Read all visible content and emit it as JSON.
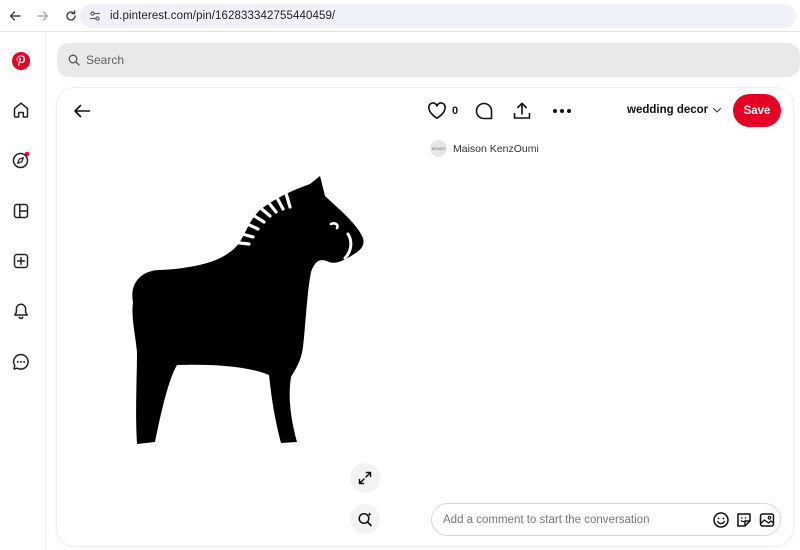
{
  "browser": {
    "url": "id.pinterest.com/pin/162833342755440459/"
  },
  "search": {
    "placeholder": "Search"
  },
  "pin": {
    "like_count": "0",
    "board_name": "wedding decor",
    "save_label": "Save",
    "author_name": "Maison KenzOumi",
    "avatar_text": "KENZO",
    "comment_placeholder": "Add a comment to start the conversation"
  },
  "colors": {
    "brand": "#e60023",
    "search_bg": "#e9e9e9",
    "url_bar_bg": "#eef1f7",
    "notification_dot": "#e60023"
  },
  "icons": {
    "sidebar": [
      "pinterest-logo-icon",
      "home-icon",
      "explore-icon",
      "boards-icon",
      "create-icon",
      "notifications-icon",
      "messages-icon"
    ],
    "pin_actions": [
      "heart-icon",
      "comment-icon",
      "share-icon",
      "more-icon"
    ],
    "image_tools": [
      "expand-icon",
      "visual-search-icon"
    ],
    "comment_tools": [
      "emoji-icon",
      "sticker-icon",
      "image-icon"
    ]
  }
}
